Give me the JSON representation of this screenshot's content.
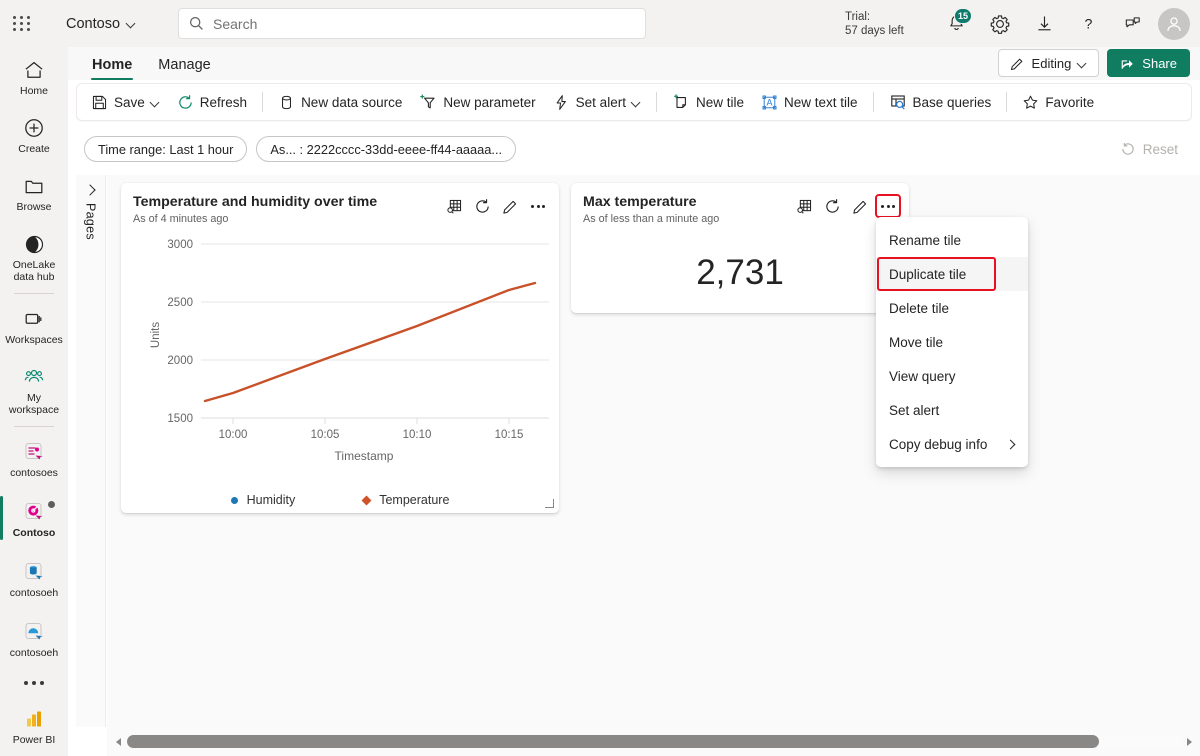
{
  "header": {
    "waffle_label": "app-launcher",
    "brand": "Contoso",
    "search_placeholder": "Search",
    "trial_line1": "Trial:",
    "trial_line2": "57 days left",
    "notification_count": "15",
    "icons": [
      "notification-bell-icon",
      "gear-icon",
      "download-icon",
      "help-icon",
      "feedback-icon",
      "account-avatar"
    ]
  },
  "sidebar": {
    "items": [
      {
        "label": "Home",
        "icon": "home-icon"
      },
      {
        "label": "Create",
        "icon": "plus-circle-icon"
      },
      {
        "label": "Browse",
        "icon": "folder-icon"
      },
      {
        "label": "OneLake data hub",
        "icon": "onelake-icon"
      },
      {
        "label": "Workspaces",
        "icon": "workspaces-icon"
      },
      {
        "label": "My workspace",
        "icon": "my-workspace-icon"
      },
      {
        "label": "contosoes",
        "icon": "eventstream-item-icon"
      },
      {
        "label": "Contoso",
        "icon": "realtime-dashboard-item-icon"
      },
      {
        "label": "contosoeh",
        "icon": "database-item-icon"
      },
      {
        "label": "contosoeh",
        "icon": "lakehouse-item-icon"
      }
    ],
    "active_item": "Contoso",
    "more_label": "more-options",
    "footer": {
      "label": "Power BI",
      "icon": "power-bi-icon"
    }
  },
  "tabs": [
    {
      "label": "Home",
      "active": true
    },
    {
      "label": "Manage",
      "active": false
    }
  ],
  "toolbar": {
    "save": "Save",
    "refresh": "Refresh",
    "new_data_source": "New data source",
    "new_parameter": "New parameter",
    "set_alert": "Set alert",
    "new_tile": "New tile",
    "new_text_tile": "New text tile",
    "base_queries": "Base queries",
    "favorite": "Favorite",
    "editing": "Editing",
    "share": "Share"
  },
  "filterbar": {
    "time_range": "Time range: Last 1 hour",
    "asset_filter": "As... : 2222cccc-33dd-eeee-ff44-aaaaa...",
    "reset": "Reset"
  },
  "pages_panel": {
    "label": "Pages",
    "expand_icon": "chevron-right-icon"
  },
  "tiles": [
    {
      "title": "Temperature and humidity over time",
      "subtitle": "As of 4 minutes ago",
      "actions": [
        "explore-data-icon",
        "refresh-icon",
        "edit-pencil-icon",
        "more-options-icon"
      ]
    },
    {
      "title": "Max temperature",
      "subtitle": "As of less than a minute ago",
      "value": "2,731",
      "actions": [
        "explore-data-icon",
        "refresh-icon",
        "edit-pencil-icon",
        "more-options-icon"
      ]
    }
  ],
  "context_menu": {
    "items": [
      {
        "label": "Rename tile",
        "highlighted": false,
        "submenu": false
      },
      {
        "label": "Duplicate tile",
        "highlighted": true,
        "submenu": false
      },
      {
        "label": "Delete tile",
        "highlighted": false,
        "submenu": false
      },
      {
        "label": "Move tile",
        "highlighted": false,
        "submenu": false
      },
      {
        "label": "View query",
        "highlighted": false,
        "submenu": false
      },
      {
        "label": "Set alert",
        "highlighted": false,
        "submenu": false
      },
      {
        "label": "Copy debug info",
        "highlighted": false,
        "submenu": true
      }
    ],
    "highlight_color": "#e81123"
  },
  "colors": {
    "brand_green": "#107c60",
    "accent_red": "#e81123",
    "humidity": "#1f77b4",
    "temperature": "#d0522a",
    "header_bg": "#f3f2f1",
    "canvas_bg": "#fafafa"
  },
  "chart_data": {
    "type": "line",
    "title": "Temperature and humidity over time",
    "xlabel": "Timestamp",
    "ylabel": "Units",
    "xticks": [
      "10:00",
      "10:05",
      "10:10",
      "10:15"
    ],
    "yticks": [
      1500,
      2000,
      2500,
      3000
    ],
    "ylim": [
      1500,
      3000
    ],
    "grid": "horizontal",
    "legend_position": "bottom",
    "series": [
      {
        "name": "Humidity",
        "color": "#1f77b4",
        "marker": "circle",
        "x": [],
        "values": []
      },
      {
        "name": "Temperature",
        "color": "#d0522a",
        "marker": "diamond",
        "x": [
          "09:58",
          "10:00",
          "10:05",
          "10:10",
          "10:15",
          "10:17"
        ],
        "values": [
          1650,
          1720,
          2010,
          2290,
          2600,
          2730
        ]
      }
    ]
  }
}
